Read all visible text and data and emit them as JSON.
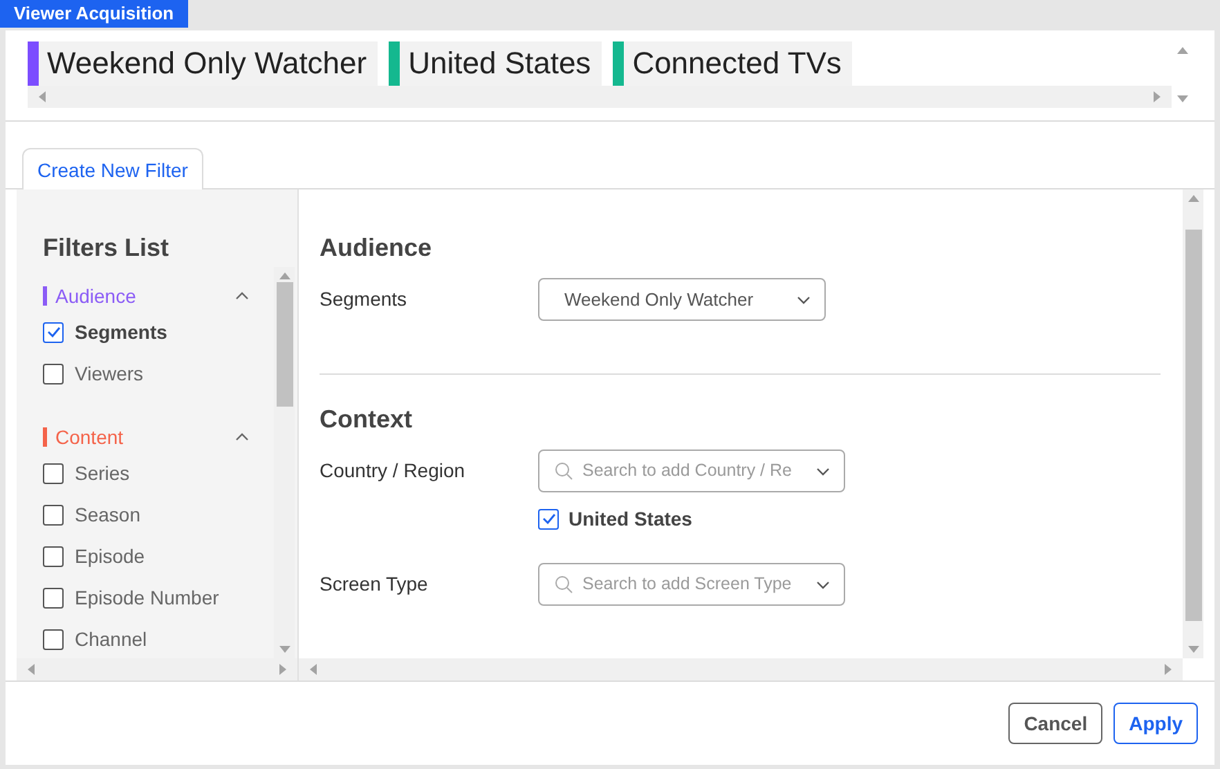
{
  "window": {
    "title": "Viewer Acquisition"
  },
  "chips": [
    {
      "label": "Weekend Only Watcher",
      "color": "#7c4dff"
    },
    {
      "label": "United States",
      "color": "#14b88f"
    },
    {
      "label": "Connected TVs",
      "color": "#14b88f"
    }
  ],
  "tabs": [
    {
      "label": "Create New Filter",
      "selected": true
    }
  ],
  "filters_list": {
    "title": "Filters List",
    "groups": [
      {
        "label": "Audience",
        "color": "#8b5cf6",
        "expanded": true,
        "items": [
          {
            "label": "Segments",
            "checked": true
          },
          {
            "label": "Viewers",
            "checked": false
          }
        ]
      },
      {
        "label": "Content",
        "color": "#f4634a",
        "expanded": true,
        "items": [
          {
            "label": "Series",
            "checked": false
          },
          {
            "label": "Season",
            "checked": false
          },
          {
            "label": "Episode",
            "checked": false
          },
          {
            "label": "Episode Number",
            "checked": false
          },
          {
            "label": "Channel",
            "checked": false
          }
        ]
      }
    ]
  },
  "sections": [
    {
      "title": "Audience",
      "fields": [
        {
          "label": "Segments",
          "kind": "select",
          "value": "Weekend Only Watcher"
        }
      ]
    },
    {
      "title": "Context",
      "fields": [
        {
          "label": "Country / Region",
          "kind": "search",
          "placeholder": "Search to add Country / Re",
          "selections": [
            {
              "label": "United States",
              "checked": true
            }
          ]
        },
        {
          "label": "Screen Type",
          "kind": "search",
          "placeholder": "Search to add Screen Type"
        }
      ]
    }
  ],
  "buttons": [
    {
      "label": "Cancel",
      "kind": "secondary"
    },
    {
      "label": "Apply",
      "kind": "primary"
    }
  ]
}
